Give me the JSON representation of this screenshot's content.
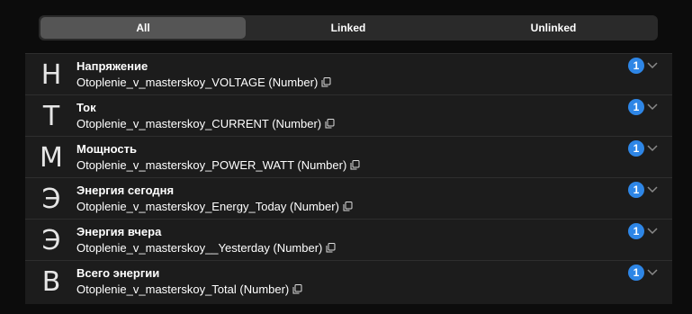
{
  "filter_tabs": [
    {
      "label": "All",
      "active": true
    },
    {
      "label": "Linked",
      "active": false
    },
    {
      "label": "Unlinked",
      "active": false
    }
  ],
  "items": [
    {
      "letter": "Н",
      "title": "Напряжение",
      "subtitle": "Otoplenie_v_masterskoy_VOLTAGE (Number)",
      "count": "1"
    },
    {
      "letter": "Т",
      "title": "Ток",
      "subtitle": "Otoplenie_v_masterskoy_CURRENT (Number)",
      "count": "1"
    },
    {
      "letter": "М",
      "title": "Мощность",
      "subtitle": "Otoplenie_v_masterskoy_POWER_WATT (Number)",
      "count": "1"
    },
    {
      "letter": "Э",
      "title": "Энергия сегодня",
      "subtitle": "Otoplenie_v_masterskoy_Energy_Today (Number)",
      "count": "1"
    },
    {
      "letter": "Э",
      "title": "Энергия вчера",
      "subtitle": "Otoplenie_v_masterskoy__Yesterday (Number)",
      "count": "1"
    },
    {
      "letter": "В",
      "title": "Всего энергии",
      "subtitle": "Otoplenie_v_masterskoy_Total (Number)",
      "count": "1"
    }
  ],
  "colors": {
    "badge": "#2e86e6",
    "background": "#0c0c0c",
    "row_background": "#1c1c1c",
    "active_tab": "#555555"
  },
  "icons": {
    "copy": "copy-icon",
    "expand": "chevron-down-icon"
  }
}
